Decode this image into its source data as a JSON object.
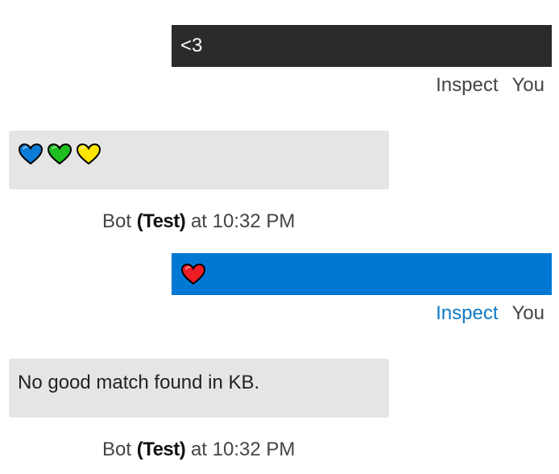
{
  "conversation": {
    "messages": [
      {
        "sender": "user",
        "text": "<3",
        "inspect_label": "Inspect",
        "sender_label": "You"
      },
      {
        "sender": "bot",
        "emoji": [
          "blue-heart",
          "green-heart",
          "yellow-heart"
        ],
        "sender_name": "Bot",
        "environment": "(Test)",
        "time_prefix": "at",
        "time": "10:32 PM"
      },
      {
        "sender": "user",
        "emoji": [
          "red-heart"
        ],
        "inspect_label": "Inspect",
        "sender_label": "You"
      },
      {
        "sender": "bot",
        "text": "No good match found in KB.",
        "sender_name": "Bot",
        "environment": "(Test)",
        "time_prefix": "at",
        "time": "10:32 PM"
      }
    ]
  },
  "colors": {
    "user_dark_bubble": "#2b2b2b",
    "user_selected_bubble": "#0078d4",
    "bot_bubble": "#e5e5e5",
    "inspect_active": "#0e7ac4",
    "heart_blue": "#0a7cd8",
    "heart_green": "#1fbf1f",
    "heart_yellow": "#ffe600",
    "heart_red": "#ee1c25"
  }
}
